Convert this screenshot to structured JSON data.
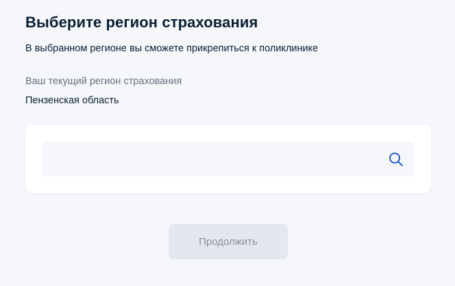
{
  "page": {
    "title": "Выберите регион страхования",
    "subtitle": "В выбранном регионе вы сможете прикрепиться к поликлинике"
  },
  "current_region": {
    "label": "Ваш текущий регион страхования",
    "value": "Пензенская область"
  },
  "search": {
    "value": "",
    "placeholder": "",
    "icon": "search-icon"
  },
  "actions": {
    "continue_label": "Продолжить",
    "continue_disabled": true
  },
  "colors": {
    "background": "#f5f7fb",
    "text_primary": "#0b1f33",
    "text_secondary": "#66727f",
    "icon_accent": "#0d4cd3",
    "button_disabled_bg": "#e4e8ee",
    "button_disabled_text": "#86909c"
  }
}
